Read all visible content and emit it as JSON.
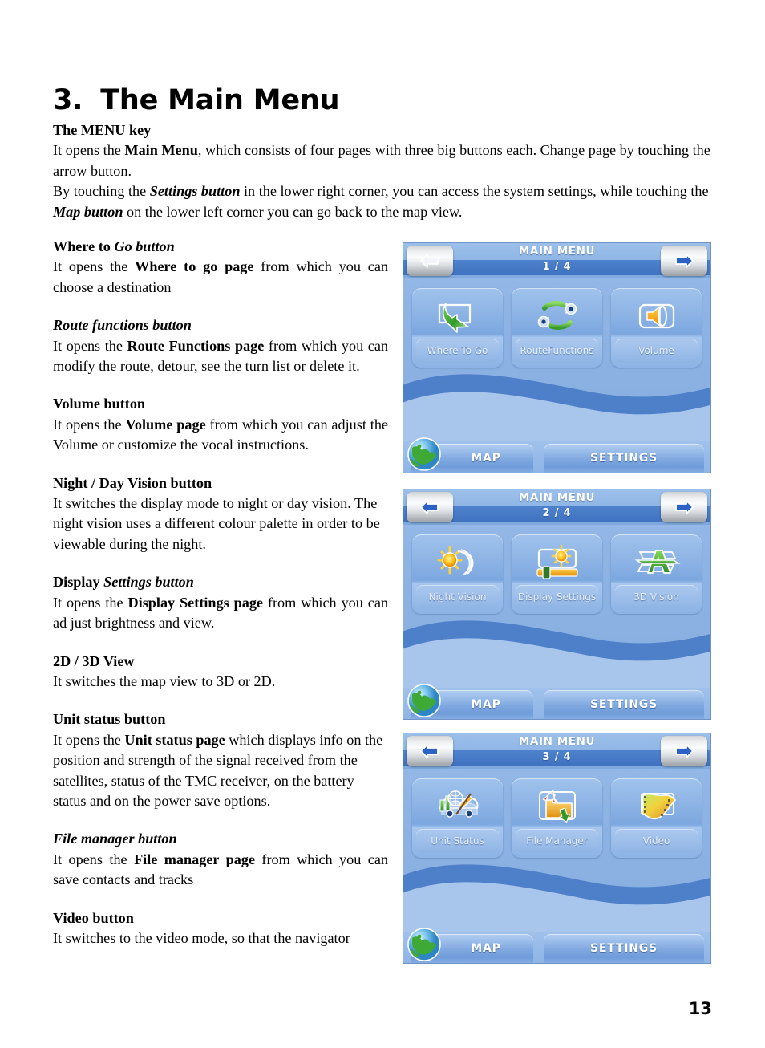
{
  "document": {
    "chapter_number": "3.",
    "chapter_title": "The Main Menu",
    "page_number": "13"
  },
  "intro": {
    "heading": "The MENU key",
    "line1_a": "It opens the ",
    "line1_b": "Main Menu",
    "line1_c": ", which consists of four pages with three big buttons each. Change page by touching the arrow button.",
    "line2_a": "By touching the ",
    "line2_b": "Settings button",
    "line2_c": " in the lower right corner, you can access the system settings, while touching the ",
    "line2_d": "Map button",
    "line2_e": " on the lower left corner you can go back to the map view."
  },
  "sections": [
    {
      "heading_plain": "Where to ",
      "heading_italic": "Go button",
      "body_a": "It opens the ",
      "body_b": "Where to go page",
      "body_c": " from which you can choose a destination"
    },
    {
      "heading_italic_full": "Route functions button",
      "body_a": "It opens the ",
      "body_b": "Route Functions page",
      "body_c": " from which you can modify the route, detour, see the turn list or delete it."
    },
    {
      "heading_plain": "Volume button",
      "body_a": "It opens the ",
      "body_b": "Volume page",
      "body_c": " from which you can adjust the Volume or customize the vocal instructions."
    },
    {
      "heading_plain": "Night / Day Vision button",
      "body_full": "It switches the display mode to night or day vision. The night vision uses a different colour palette in order to be viewable during the night."
    },
    {
      "heading_plain": "Display ",
      "heading_italic": "Settings button",
      "body_a": "It opens the ",
      "body_b": "Display Settings page",
      "body_c": " from which you can ad just brightness and view."
    },
    {
      "heading_plain": "2D / 3D View",
      "body_full": "It switches the map view to 3D or 2D."
    },
    {
      "heading_plain": "Unit status button",
      "body_a": "It opens the ",
      "body_b": "Unit status page",
      "body_c": " which displays info on the position and strength of the signal received from the satellites, status of the TMC receiver, on the battery status and on the power save options."
    },
    {
      "heading_italic_full": "File manager button",
      "body_a": "It opens the ",
      "body_b": "File manager page",
      "body_c": " from which you can save contacts and tracks"
    },
    {
      "heading_plain": "Video button",
      "body_full": "It switches to the video mode, so that the navigator"
    }
  ],
  "screens": [
    {
      "title": "MAIN MENU",
      "page_indicator": "1 / 4",
      "back_arrow_state": "disabled",
      "forward_arrow_state": "enabled",
      "buttons": [
        {
          "label": "Where To Go",
          "icon": "where-to-go-icon"
        },
        {
          "label": "Route\nFunctions",
          "label_line1": "Route",
          "label_line2": "Functions",
          "icon": "route-functions-icon"
        },
        {
          "label": "Volume",
          "icon": "volume-icon"
        }
      ],
      "map_label": "MAP",
      "settings_label": "SETTINGS"
    },
    {
      "title": "MAIN MENU",
      "page_indicator": "2 / 4",
      "back_arrow_state": "enabled",
      "forward_arrow_state": "enabled",
      "buttons": [
        {
          "label": "Night Vision",
          "icon": "night-vision-icon"
        },
        {
          "label": "Display Settings",
          "icon": "display-settings-icon"
        },
        {
          "label": "3D Vision",
          "icon": "3d-vision-icon"
        }
      ],
      "map_label": "MAP",
      "settings_label": "SETTINGS"
    },
    {
      "title": "MAIN MENU",
      "page_indicator": "3 / 4",
      "back_arrow_state": "enabled",
      "forward_arrow_state": "enabled",
      "buttons": [
        {
          "label": "Unit Status",
          "icon": "unit-status-icon"
        },
        {
          "label": "File Manager",
          "icon": "file-manager-icon"
        },
        {
          "label": "Video",
          "icon": "video-icon"
        }
      ],
      "map_label": "MAP",
      "settings_label": "SETTINGS"
    }
  ],
  "colors": {
    "screen_bg": "#8db2e3",
    "title_band": "#4579c6",
    "wave_dark": "#4e7fc9",
    "wave_light": "#a8c5ec",
    "button_face": "#8fb5e6",
    "text_white": "#ffffff",
    "green_accent": "#4aa832",
    "orange_accent": "#f5a623"
  }
}
